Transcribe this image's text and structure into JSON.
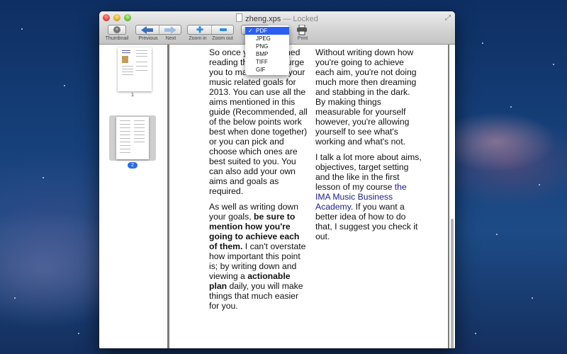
{
  "window": {
    "filename": "zheng.xps",
    "status": " — Locked"
  },
  "toolbar": {
    "thumbnail_label": "Thumbnail",
    "previous_label": "Previous",
    "next_label": "Next",
    "zoom_in_label": "Zoom in",
    "zoom_out_label": "Zoom out",
    "print_label": "Print"
  },
  "export_menu": {
    "selected": "PDF",
    "options": [
      "PDF",
      "JPEG",
      "PNG",
      "BMP",
      "TIFF",
      "GIF"
    ]
  },
  "sidebar": {
    "pages": [
      {
        "number": "1",
        "selected": false
      },
      {
        "number": "2",
        "selected": true
      }
    ]
  },
  "document": {
    "col1": {
      "p1": "So once you've finished reading this guide, I urge you to make a list of your music related goals for 2013. You can use all the aims mentioned in this guide (Recommended, all of the below points work best when done together) or you can pick and choose which ones are best suited to you. You can also add your own aims and goals as required.",
      "p2_a": "As well as writing down your goals, ",
      "p2_b": "be sure to mention how you're going to achieve each of them.",
      "p2_c": " I can't overstate how important this point is; by writing down and viewing a ",
      "p2_d": "actionable plan",
      "p2_e": " daily, you will make things that much easier for you."
    },
    "col2": {
      "p1": "Without writing down how you're going to achieve each aim, you're not doing much more then dreaming and stabbing in the dark. By making things measurable for yourself however, you're allowing yourself to see what's working and what's not.",
      "p2_a": "I talk a lot more about aims, objectives, target setting and the like in the first lesson of my course ",
      "p2_link": "the IMA Music Business Academy",
      "p2_b": ". If you want a better idea of how to do that, I suggest you check it out."
    }
  }
}
